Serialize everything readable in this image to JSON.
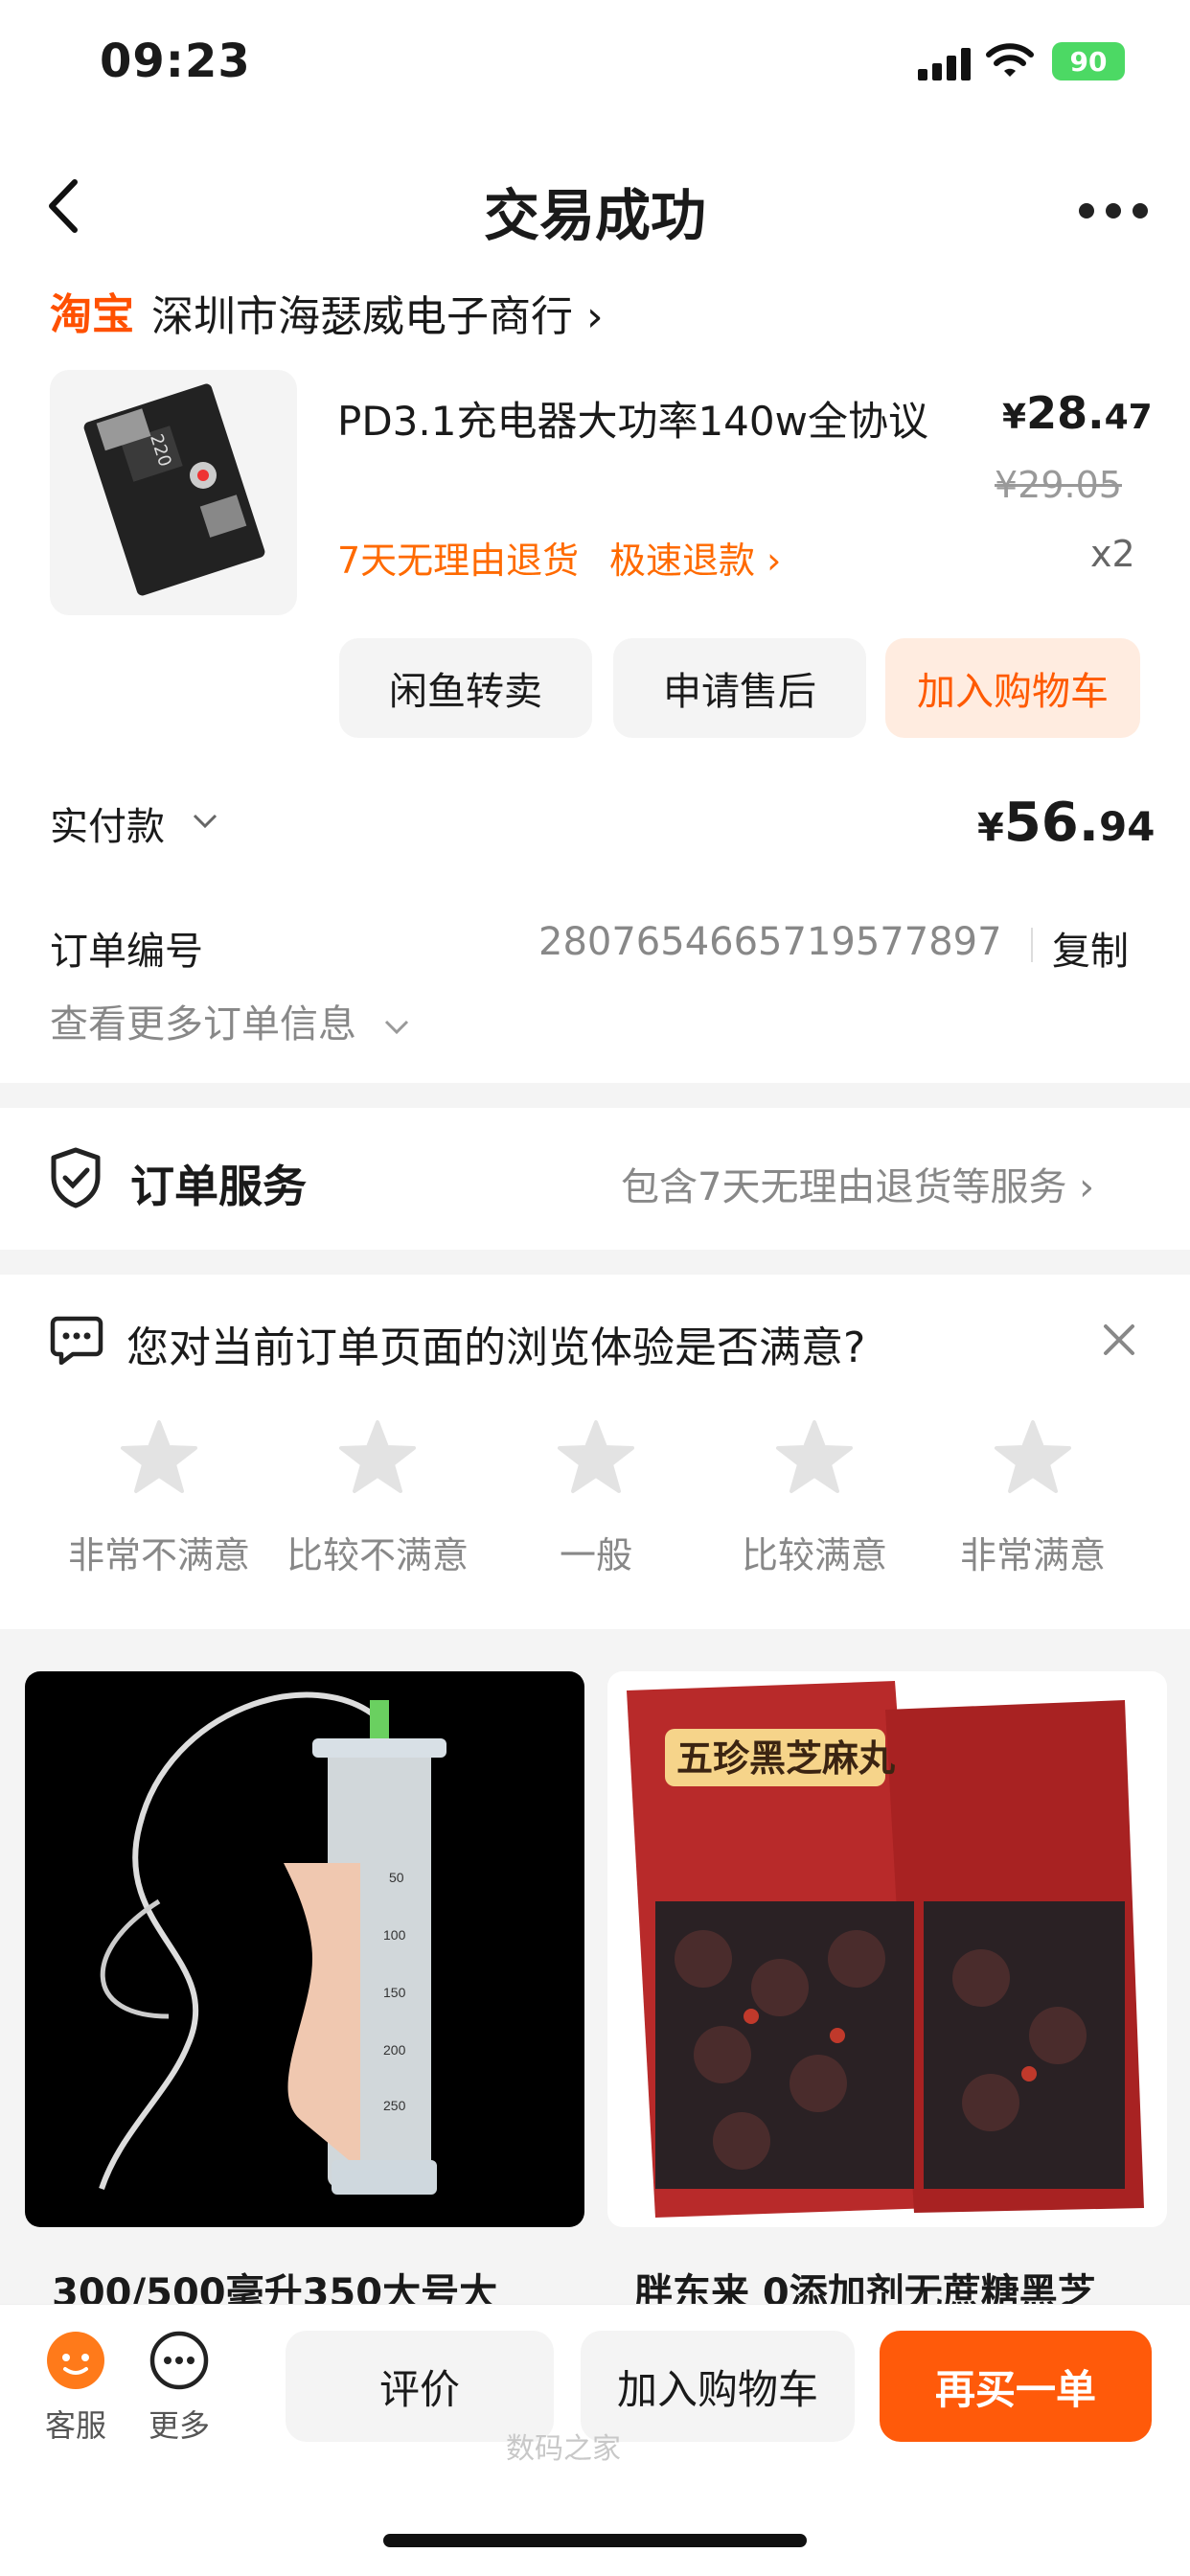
{
  "status_bar": {
    "time": "09:23",
    "battery": "90"
  },
  "nav": {
    "title": "交易成功"
  },
  "shop": {
    "logo": "淘宝",
    "name": "深圳市海瑟威电子商行 ›"
  },
  "product": {
    "title": "PD3.1充电器大功率140w全协议",
    "price_symbol": "¥",
    "price_int": "28.",
    "price_dec": "47",
    "old_price": "¥29.05",
    "tag_return": "7天无理由退货",
    "tag_refund": "极速退款 ›",
    "qty": "x2",
    "img_label": "220"
  },
  "actions": {
    "resell": "闲鱼转卖",
    "after_sale": "申请售后",
    "add_cart": "加入购物车"
  },
  "payment": {
    "label": "实付款",
    "symbol": "¥",
    "amount_int": "56.",
    "amount_dec": "94"
  },
  "order": {
    "label": "订单编号",
    "number": "2807654665719577897",
    "copy": "复制",
    "view_more": "查看更多订单信息"
  },
  "service": {
    "title": "订单服务",
    "desc": "包含7天无理由退货等服务 ›"
  },
  "survey": {
    "question": "您对当前订单页面的浏览体验是否满意?",
    "options": [
      "非常不满意",
      "比较不满意",
      "一般",
      "比较满意",
      "非常满意"
    ]
  },
  "recommendations": [
    {
      "title": "300/500毫升350大号大",
      "image_desc": "syringe"
    },
    {
      "title": "胖东来 0添加剂无蔗糖黑芝",
      "image_desc": "black sesame pills",
      "pack_text": "五珍黑芝麻丸"
    }
  ],
  "bottom_bar": {
    "service_label": "客服",
    "more_label": "更多",
    "review": "评价",
    "add_cart": "加入购物车",
    "rebuy": "再买一单",
    "watermark": "数码之家"
  },
  "colors": {
    "accent": "#ff5000",
    "orange_text": "#ff6a00",
    "rebuy_bg": "#ff5a0a"
  }
}
